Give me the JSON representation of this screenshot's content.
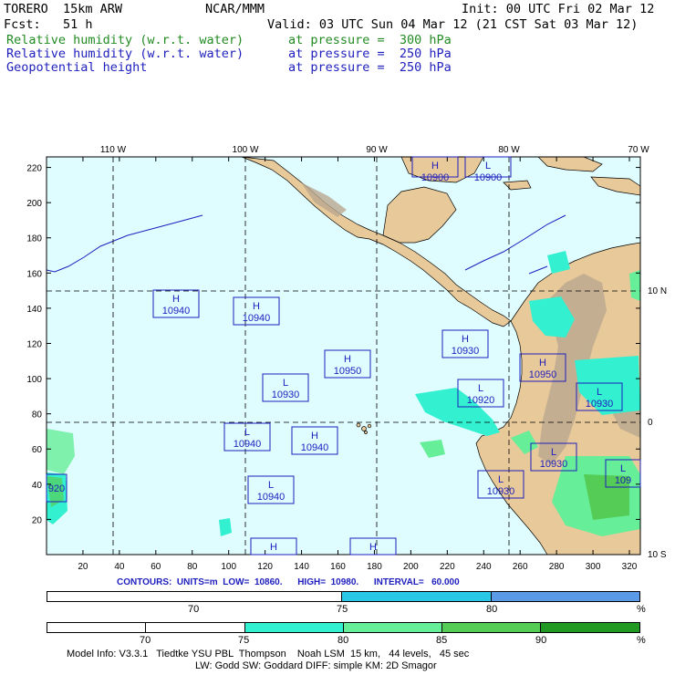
{
  "header": {
    "model": "TORERO  15km ARW",
    "org": "NCAR/MMM",
    "init": "Init: 00 UTC Fri 02 Mar 12",
    "fcst": "Fcst:   51 h",
    "valid": "Valid: 03 UTC Sun 04 Mar 12 (21 CST Sat 03 Mar 12)",
    "fields": [
      {
        "name": "Relative humidity (w.r.t. water)",
        "level": "at pressure =  300 hPa",
        "color": "#228b22"
      },
      {
        "name": "Relative humidity (w.r.t. water)",
        "level": "at pressure =  250 hPa",
        "color": "#1e1ebe"
      },
      {
        "name": "Geopotential height",
        "level": "at pressure =  250 hPa",
        "color": "#1e1ebe"
      }
    ]
  },
  "map": {
    "lon_labels": [
      "110 W",
      "100 W",
      "90 W",
      "80 W",
      "70 W"
    ],
    "lat_labels": [
      "10 N",
      "0",
      "10 S"
    ],
    "x_ticks": [
      "20",
      "40",
      "60",
      "80",
      "100",
      "120",
      "140",
      "160",
      "180",
      "200",
      "220",
      "240",
      "260",
      "280",
      "300",
      "320"
    ],
    "y_ticks": [
      "220",
      "200",
      "180",
      "160",
      "140",
      "120",
      "100",
      "80",
      "60",
      "40",
      "20"
    ],
    "ocean_color": "#dffcff",
    "land_color": "#e8c99a",
    "highs_lows": [
      {
        "type": "H",
        "value": "10900"
      },
      {
        "type": "L",
        "value": "10900"
      },
      {
        "type": "H",
        "value": "10940"
      },
      {
        "type": "H",
        "value": "10940"
      },
      {
        "type": "H",
        "value": "10950"
      },
      {
        "type": "H",
        "value": "10930"
      },
      {
        "type": "H",
        "value": "10950"
      },
      {
        "type": "L",
        "value": "10930"
      },
      {
        "type": "L",
        "value": "10920"
      },
      {
        "type": "L",
        "value": "10930"
      },
      {
        "type": "L",
        "value": "10940"
      },
      {
        "type": "H",
        "value": "10940"
      },
      {
        "type": "L",
        "value": "10930"
      },
      {
        "type": "L",
        "value": "10940"
      },
      {
        "type": "L",
        "value": "10930"
      },
      {
        "type": "L",
        "value": "109"
      },
      {
        "type": "H",
        "value": ""
      },
      {
        "type": "H",
        "value": ""
      },
      {
        "type": "",
        "value": "920"
      }
    ]
  },
  "contours_info": "CONTOURS:  UNITS=m  LOW=  10860.      HIGH=  10980.      INTERVAL=   60.000",
  "colorbar1": {
    "labels": [
      "70",
      "75",
      "80",
      "%"
    ],
    "colors": [
      "#ffffff",
      "#28c8e6",
      "#5a9ae6"
    ]
  },
  "colorbar2": {
    "labels": [
      "70",
      "75",
      "80",
      "85",
      "90",
      "%"
    ],
    "colors": [
      "#ffffff",
      "#ffffff",
      "#33f0d0",
      "#66ee99",
      "#55cc55",
      "#229922"
    ]
  },
  "footer": {
    "line1": "Model Info: V3.3.1   Tiedtke YSU PBL  Thompson    Noah LSM  15 km,   44 levels,   45 sec",
    "line2": "LW: Godd SW: Goddard DIFF: simple KM: 2D Smagor"
  }
}
